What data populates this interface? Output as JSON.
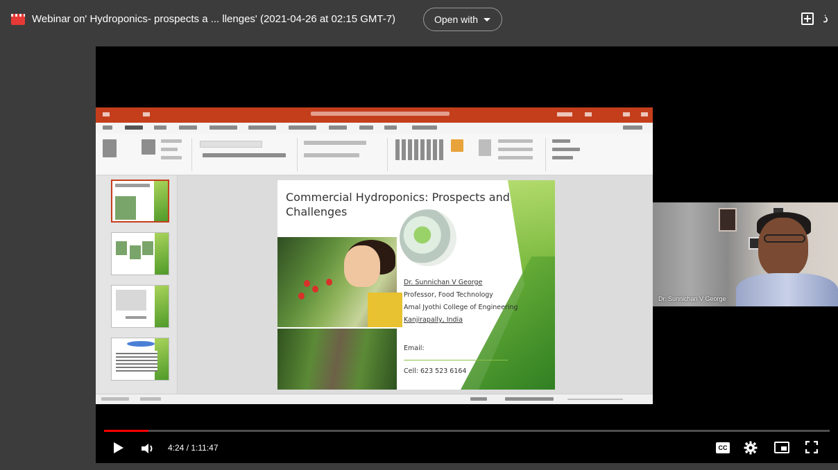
{
  "topbar": {
    "file_icon": "video-file-icon",
    "title": "Webinar on' Hydroponics- prospects a ... llenges' (2021-04-26 at 02:15 GMT-7)",
    "open_with_label": "Open with",
    "add_icon": "add-to-drive-icon",
    "more_glyph": "ذ"
  },
  "slide": {
    "title": "Commercial Hydroponics: Prospects and Challenges",
    "presenter_name": "Dr. Sunnichan V George",
    "presenter_role": "Professor, Food Technology",
    "institution": "Amal Jyothi College of Engineering",
    "location": "Kanjirapally, India",
    "email_label": "Email:",
    "cell": "Cell: 623 523 6164"
  },
  "webcam": {
    "name": "Dr. Sunnichan V George"
  },
  "player": {
    "time": "4:24 / 1:11:47",
    "progress_fraction": 0.061,
    "cc_label": "CC"
  },
  "colors": {
    "progress_red": "#ff0000",
    "ppt_orange": "#c43e1c",
    "slide_green": "#6bb032"
  }
}
